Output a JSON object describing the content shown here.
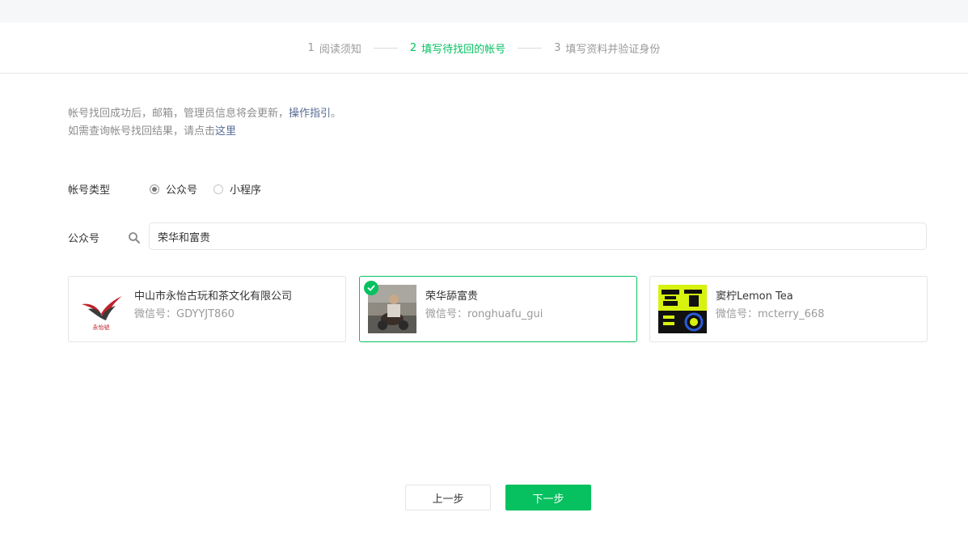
{
  "steps": [
    {
      "num": "1",
      "label": "阅读须知",
      "state": "done"
    },
    {
      "num": "2",
      "label": "填写待找回的帐号",
      "state": "active"
    },
    {
      "num": "3",
      "label": "填写资料并验证身份",
      "state": "todo"
    }
  ],
  "notice": {
    "line1_prefix": "帐号找回成功后，邮箱，管理员信息将会更新，",
    "line1_link": "操作指引",
    "line1_suffix": "。",
    "line2_prefix": "如需查询帐号找回结果，请点击",
    "line2_link": "这里"
  },
  "account_type": {
    "label": "帐号类型",
    "options": [
      {
        "label": "公众号",
        "checked": true
      },
      {
        "label": "小程序",
        "checked": false
      }
    ]
  },
  "search": {
    "label": "公众号",
    "value": "荣华和富贵",
    "icon": "search-icon"
  },
  "results": [
    {
      "name": "中山市永怡古玩和茶文化有限公司",
      "wechat_label": "微信号：",
      "wechat_id": "GDYYJT860",
      "selected": false,
      "avatar_text": "永怡號"
    },
    {
      "name": "荣华舔富贵",
      "wechat_label": "微信号：",
      "wechat_id": "ronghuafu_gui",
      "selected": true
    },
    {
      "name": "窦柠Lemon Tea",
      "wechat_label": "微信号：",
      "wechat_id": "mcterry_668",
      "selected": false
    }
  ],
  "buttons": {
    "prev": "上一步",
    "next": "下一步"
  },
  "colors": {
    "accent": "#07c160",
    "link": "#576b95",
    "muted": "#9a9a9a"
  }
}
